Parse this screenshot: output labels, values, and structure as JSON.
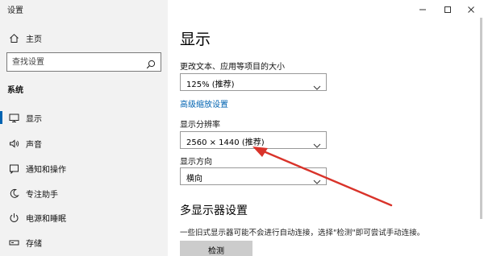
{
  "window": {
    "title": "设置"
  },
  "sidebar": {
    "home": "主页",
    "search_placeholder": "查找设置",
    "section": "系统",
    "items": [
      {
        "label": "显示",
        "icon": "monitor-icon",
        "selected": true
      },
      {
        "label": "声音",
        "icon": "speaker-icon"
      },
      {
        "label": "通知和操作",
        "icon": "notification-icon"
      },
      {
        "label": "专注助手",
        "icon": "moon-icon"
      },
      {
        "label": "电源和睡眠",
        "icon": "power-icon"
      },
      {
        "label": "存储",
        "icon": "storage-icon"
      }
    ]
  },
  "main": {
    "title": "显示",
    "scale_label": "更改文本、应用等项目的大小",
    "scale_value": "125% (推荐)",
    "advanced_scale_link": "高级缩放设置",
    "resolution_label": "显示分辨率",
    "resolution_value": "2560 × 1440 (推荐)",
    "orientation_label": "显示方向",
    "orientation_value": "横向",
    "multi_display_title": "多显示器设置",
    "multi_display_desc": "一些旧式显示器可能不会进行自动连接，选择\"检测\"即可尝试手动连接。",
    "detect_button": "检测"
  },
  "colors": {
    "accent": "#0063b1",
    "sidebar_bg": "#f2f2f2",
    "annotation_arrow": "#d9332a"
  }
}
